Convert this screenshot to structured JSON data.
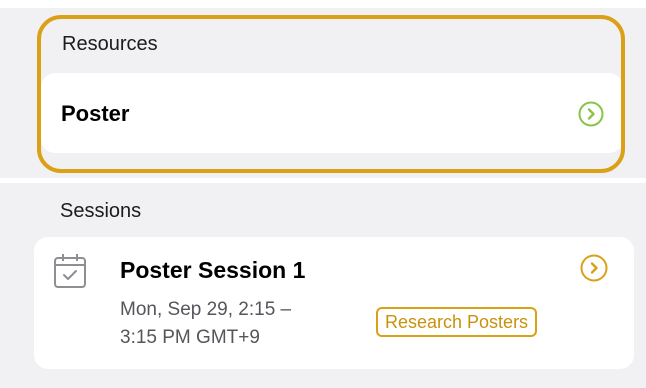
{
  "resources": {
    "heading": "Resources",
    "items": [
      {
        "label": "Poster",
        "icon": "chevron-right-circle-icon",
        "accent": "#8bc34a"
      }
    ]
  },
  "sessions": {
    "heading": "Sessions",
    "items": [
      {
        "title": "Poster Session 1",
        "time": "Mon, Sep 29, 2:15 – 3:15 PM GMT+9",
        "tag": "Research Posters",
        "icon": "calendar-check-icon",
        "accent": "#dba116"
      }
    ]
  },
  "colors": {
    "highlight": "#dba116",
    "background": "#f1f1f4"
  }
}
